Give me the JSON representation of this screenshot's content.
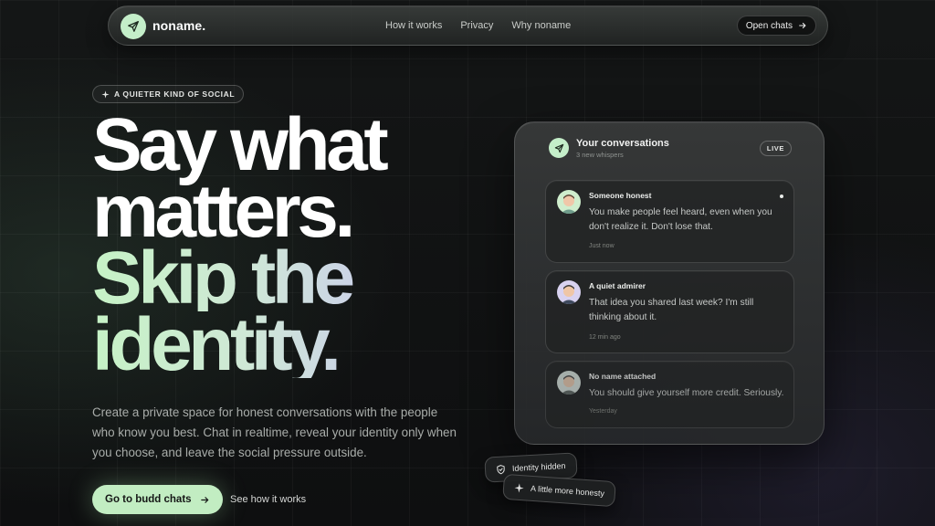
{
  "nav": {
    "brand": "noname.",
    "links": [
      "How it works",
      "Privacy",
      "Why noname"
    ],
    "cta_label": "Open chats"
  },
  "hero": {
    "tag": "A QUIETER KIND OF SOCIAL",
    "headline": [
      "Say what",
      "matters.",
      "Skip the",
      "identity."
    ],
    "description": "Create a private space for honest conversations with the people who know you best. Chat in realtime, reveal your identity only when you choose, and leave the social pressure outside.",
    "primary_cta": "Go to budd chats",
    "secondary_cta": "See how it works"
  },
  "panel": {
    "title": "Your conversations",
    "subtitle": "3 new whispers",
    "badge": "LIVE",
    "messages": [
      {
        "sender": "Someone honest",
        "text": "You make people feel heard, even when you don't realize it. Don't lose that.",
        "time": "Just now",
        "unread": true
      },
      {
        "sender": "A quiet admirer",
        "text": "That idea you shared last week? I'm still thinking about it.",
        "time": "12 min ago",
        "unread": false
      },
      {
        "sender": "No name attached",
        "text": "You should give yourself more credit. Seriously.",
        "time": "Yesterday",
        "unread": false
      }
    ]
  },
  "chips": {
    "identity": "Identity hidden",
    "honesty": "A little more honesty"
  },
  "icons": {
    "logo": "paper-plane-icon",
    "arrow": "arrow-right-icon",
    "sparkle": "sparkle-icon",
    "shield": "shield-icon"
  },
  "colors": {
    "accent": "#c2edc2",
    "background": "#121414",
    "gradient_end": "#b9aef2"
  }
}
